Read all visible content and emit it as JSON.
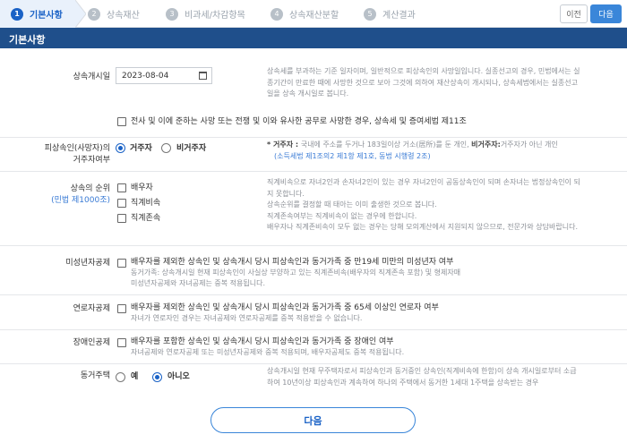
{
  "steps": [
    {
      "num": "1",
      "label": "기본사항"
    },
    {
      "num": "2",
      "label": "상속재산"
    },
    {
      "num": "3",
      "label": "비과세/차감항목"
    },
    {
      "num": "4",
      "label": "상속재산분할"
    },
    {
      "num": "5",
      "label": "계산결과"
    }
  ],
  "nav": {
    "prev": "이전",
    "next": "다음"
  },
  "section_title": "기본사항",
  "start_date": {
    "label": "상속개시일",
    "value": "2023-08-04",
    "help": [
      "상속세를 부과하는 기준 일자이며, 일반적으로 피상속인의 사망일입니다. 실종선고의 경우, 민법에서는 실",
      "종기간이 만료한 때에 사망한 것으로 보아 그것에 의하여 재산상속이 개시되나, 상속세법에서는 실종선고",
      "일을 상속 개시일로 봅니다."
    ],
    "war_checkbox": "전사 및 이에 준하는 사망 또는 전쟁 및 이와 유사한 공무로 사망한 경우, 상속세 및 증여세법 제11조"
  },
  "residency": {
    "label1": "피상속인(사망자)의",
    "label2": "거주자여부",
    "opt_resident": "거주자",
    "opt_nonresident": "비거주자",
    "help1_pre": "* 거주자 : ",
    "help1_mid": "국내에 주소를 두거나 183일이상 거소(居所)를 둔 개인, ",
    "help1_b": "비거주자:",
    "help1_post": "거주자가 아닌 개인",
    "help2": "(소득세법 제1조의2 제1항 제1호, 동법 시행령 2조)"
  },
  "order": {
    "label1": "상속의 순위",
    "label2": "(민법 제1000조)",
    "opts": [
      "배우자",
      "직계비속",
      "직계존속"
    ],
    "help": [
      "직계비속으로 자녀2인과 손자녀2인이 있는 경우 자녀2인이 공동상속인이 되며 손자녀는 법정상속인이 되",
      "지 못합니다.",
      "상속순위를 결정할 때 태아는 이미 출생한 것으로 봅니다.",
      "직계존속여부는 직계비속이 없는 경우에 한합니다.",
      "배우자나 직계존비속이 모두 없는 경우는 당해 모의계산에서 지원되지 않으므로, 전문가와 상담바랍니다."
    ]
  },
  "minor": {
    "label": "미성년자공제",
    "text": "배우자를 제외한 상속인 및 상속개시 당시 피상속인과 동거가족 중 만19세 미만의 미성년자 여부",
    "sub1": "동거가족: 상속개시일 현재 피상속인이 사실상 부양하고 있는 직계존비속(배우자의 직계존속 포함) 및 형제자매",
    "sub2": "미성년자공제와 자녀공제는 중복 적용됩니다."
  },
  "elder": {
    "label": "연로자공제",
    "text": "배우자를 제외한 상속인 및 상속개시 당시 피상속인과 동거가족 중 65세 이상인 연로자 여부",
    "sub1": "자녀가 연로자인 경우는 자녀공제와 연로자공제를 중복 적용받을 수 없습니다."
  },
  "disabled": {
    "label": "장애인공제",
    "text": "배우자를 포함한 상속인 및 상속개시 당시 피상속인과 동거가족 중 장애인 여부",
    "sub1": "자녀공제와 연로자공제 또는 미성년자공제와 중복 적용되며, 배우자공제도 중복 적용됩니다."
  },
  "cohabit": {
    "label": "동거주택",
    "opt_yes": "예",
    "opt_no": "아니오",
    "help": [
      "상속개시일 현재 무주택자로서 피상속인과 동거중인 상속인(직계비속에 한함)이 상속 개시일로부터 소급",
      "하여 10년이상 피상속인과 계속하여 하나의 주택에서 동거한 1세대 1주택을 상속받는 경우"
    ]
  },
  "bottom_next": "다음",
  "colors": {
    "primary": "#1a62c6",
    "header_bg": "#1f4f8b",
    "accent": "#3a86d9"
  }
}
